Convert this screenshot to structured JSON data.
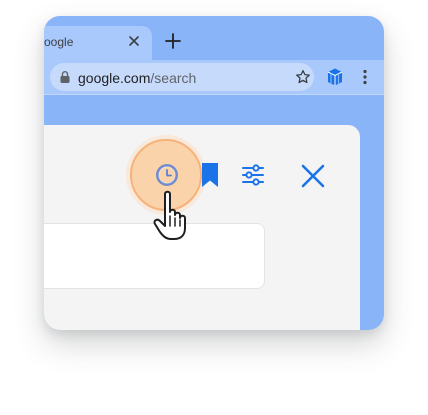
{
  "browser": {
    "tab": {
      "title": "oogle",
      "close_icon": "close-icon"
    },
    "new_tab_icon": "plus-icon",
    "omnibox": {
      "host": "google.com",
      "path": "/search",
      "lock_icon": "lock-icon",
      "star_icon": "star-outline-icon"
    },
    "extension_icon": "extension-cube-icon",
    "menu_icon": "three-dots-vertical-icon"
  },
  "panel": {
    "buttons": [
      {
        "name": "history",
        "icon": "clock-icon",
        "highlighted": true
      },
      {
        "name": "bookmark",
        "icon": "bookmark-icon"
      },
      {
        "name": "filters",
        "icon": "tune-sliders-icon"
      },
      {
        "name": "close",
        "icon": "close-x-icon"
      }
    ],
    "input": {
      "value": "",
      "placeholder": ""
    },
    "cursor": "hand-pointer-cursor"
  },
  "colors": {
    "window_bg": "#8ab4f8",
    "chrome_bg": "#a9c8fb",
    "omnibox_bg": "#c6dafc",
    "panel_bg": "#f4f4f4",
    "accent_blue": "#1a73e8",
    "highlight_fill": "#fbd3ab",
    "highlight_ring": "#f7b27a"
  }
}
